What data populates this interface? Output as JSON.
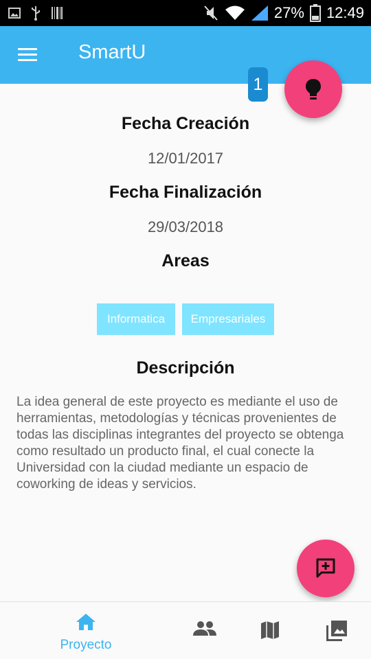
{
  "status_bar": {
    "battery": "27%",
    "time": "12:49",
    "icons": [
      "image-icon",
      "usb-icon",
      "barcode-icon",
      "mute-icon",
      "wifi-icon",
      "signal-icon",
      "battery-icon"
    ]
  },
  "app_bar": {
    "title": "SmartU",
    "color": "#3cb4f0",
    "menu_icon": "menu-icon"
  },
  "badge": {
    "count": "1"
  },
  "fabs": {
    "idea_icon": "lightbulb-icon",
    "comment_icon": "add-comment-icon",
    "color": "#f2407a"
  },
  "project": {
    "creation_label": "Fecha Creación",
    "creation_date": "12/01/2017",
    "end_label": "Fecha Finalización",
    "end_date": "29/03/2018",
    "areas_label": "Areas",
    "areas": [
      "Informatica",
      "Empresariales"
    ],
    "description_label": "Descripción",
    "description": "La idea general de este proyecto es mediante el uso de herramientas, metodologías y técnicas provenientes de todas las disciplinas integrantes del proyecto se obtenga como resultado un producto final, el cual conecte la Universidad con la ciudad mediante un espacio de coworking de ideas y servicios."
  },
  "bottom_nav": {
    "active_label": "Proyecto",
    "icons": [
      "home-icon",
      "people-icon",
      "map-icon",
      "gallery-icon"
    ],
    "active_color": "#3cb4f0"
  }
}
